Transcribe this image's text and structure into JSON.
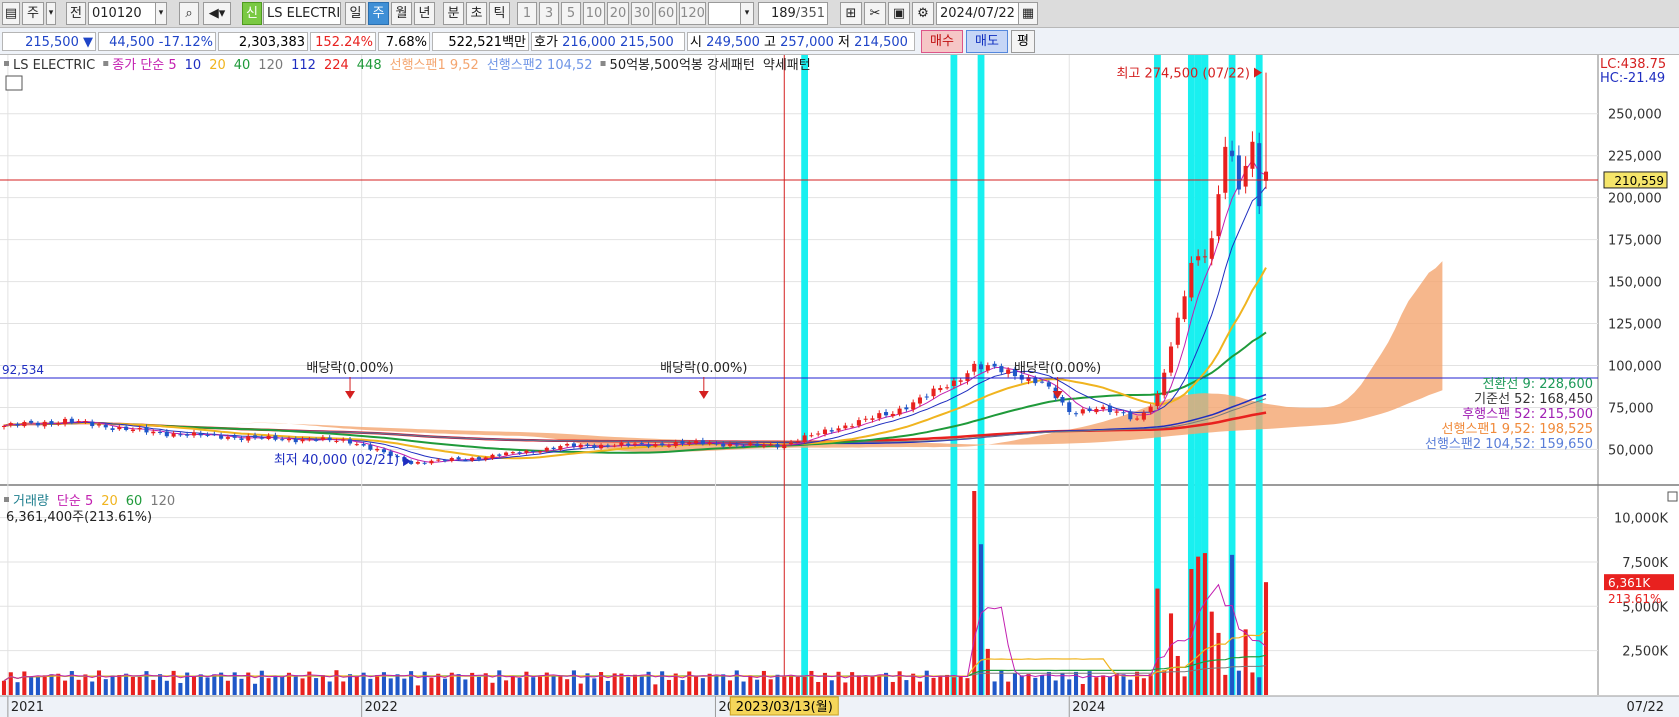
{
  "toolbar": {
    "period_label": "주",
    "prev_label": "전",
    "code": "010120",
    "new_badge": "신",
    "stock_name": "LS ELECTRI",
    "timeframes": [
      "일",
      "주",
      "월",
      "년",
      "분",
      "초",
      "틱"
    ],
    "active_timeframe": "주",
    "minute_options": [
      "1",
      "3",
      "5",
      "10",
      "20",
      "30",
      "60",
      "120"
    ],
    "bar_count": "189",
    "bar_total": "/351",
    "date": "2024/07/22"
  },
  "quote": {
    "price": "215,500",
    "change_arrow": "▼",
    "change": "44,500",
    "change_pct": "-17.12%",
    "volume": "2,303,383",
    "volume_ratio": "152.24%",
    "turnover": "7.68%",
    "trade_value": "522,521백만",
    "bid_label": "호가",
    "ask_price": "216,000",
    "bid_price": "215,500",
    "open_label": "시",
    "open": "249,500",
    "high_label": "고",
    "high": "257,000",
    "low_label": "저",
    "low": "214,500",
    "buy_label": "매수",
    "sell_label": "매도",
    "avg_label": "평"
  },
  "colors": {
    "up": "#e8211f",
    "down": "#1f57c8",
    "cyan_band": "#19f0f0",
    "cloud_up": "#f4a56f",
    "cloud_down": "#6f95e6",
    "ma5": "#c21fb0",
    "ma10": "#1f2ec0",
    "ma20": "#f0b41f",
    "ma40": "#1f9a3a",
    "ma120": "#7a7a7a"
  },
  "chart_data": [
    {
      "type": "candlestick",
      "title": "LS ELECTRIC",
      "legend": [
        {
          "text": "LS ELECTRIC",
          "color": "#333333"
        },
        {
          "text": "종가 단순 5",
          "color": "#c21fb0"
        },
        {
          "text": "10",
          "color": "#1f2ec0"
        },
        {
          "text": "20",
          "color": "#f0b41f"
        },
        {
          "text": "40",
          "color": "#1f9a3a"
        },
        {
          "text": "120",
          "color": "#7a7a7a"
        },
        {
          "text": "112",
          "color": "#1f2ec0"
        },
        {
          "text": "224",
          "color": "#e8211f"
        },
        {
          "text": "448",
          "color": "#1f9a3a"
        },
        {
          "text": "선행스팬1 9,52",
          "color": "#f4a56f"
        },
        {
          "text": "선행스팬2 104,52",
          "color": "#6f95e6"
        },
        {
          "text": "50억봉,500억봉 강세패턴",
          "color": "#222222"
        },
        {
          "text": "약세패턴",
          "color": "#222222"
        }
      ],
      "y_ticks": [
        50000,
        75000,
        100000,
        125000,
        150000,
        175000,
        200000,
        225000,
        250000
      ],
      "y_tick_labels": [
        "50,000",
        "75,000",
        "100,000",
        "125,000",
        "150,000",
        "175,000",
        "200,000",
        "225,000",
        "250,000"
      ],
      "ylim": [
        30000,
        285000
      ],
      "x_labels": [
        {
          "text": "2021",
          "date": "2021-01"
        },
        {
          "text": "2022",
          "date": "2022-01"
        },
        {
          "text": "2023",
          "date": "2023-01"
        },
        {
          "text": "2024",
          "date": "2024-01"
        }
      ],
      "right_top": {
        "lc": "LC:438.75",
        "hc": "HC:-21.49"
      },
      "current_price_tag": "210,559",
      "current_price": 210559,
      "horizontal_line": {
        "value": 92534,
        "label": "92,534"
      },
      "crosshair": {
        "date": "2023/03/13(월)"
      },
      "high_marker": {
        "text": "최고 274,500 (07/22)",
        "value": 274500
      },
      "low_marker": {
        "text": "최저 40,000 (02/21)",
        "value": 40000
      },
      "dividend_markers": [
        {
          "text": "배당락(0.00%)",
          "date": "2021-12"
        },
        {
          "text": "배당락(0.00%)",
          "date": "2022-12"
        },
        {
          "text": "배당락(0.00%)",
          "date": "2023-12"
        }
      ],
      "right_legend": [
        {
          "text": "전환선 9: 228,600",
          "color": "#1f9a5a"
        },
        {
          "text": "기준선 52: 168,450",
          "color": "#333333"
        },
        {
          "text": "후행스팬 52: 215,500",
          "color": "#a01fb4"
        },
        {
          "text": "선행스팬1 9,52: 198,525",
          "color": "#f08a3a"
        },
        {
          "text": "선행스팬2 104,52: 159,650",
          "color": "#5a7ed8"
        }
      ],
      "cyan_band_dates": [
        "2023-04-03",
        "2023-09-04",
        "2023-10-02",
        "2024-04-01",
        "2024-05-06",
        "2024-05-13",
        "2024-05-20",
        "2024-06-17",
        "2024-07-15"
      ],
      "keypoints": [
        {
          "date": "2020-12-28",
          "close": 64000
        },
        {
          "date": "2021-03-01",
          "close": 67000
        },
        {
          "date": "2021-06-01",
          "close": 60000
        },
        {
          "date": "2021-09-01",
          "close": 57000
        },
        {
          "date": "2021-12-20",
          "close": 55000
        },
        {
          "date": "2022-02-21",
          "close": 42000
        },
        {
          "date": "2022-05-01",
          "close": 45000
        },
        {
          "date": "2022-08-01",
          "close": 52000
        },
        {
          "date": "2022-11-01",
          "close": 53000
        },
        {
          "date": "2022-12-26",
          "close": 54000
        },
        {
          "date": "2023-02-01",
          "close": 52000
        },
        {
          "date": "2023-03-13",
          "close": 53000
        },
        {
          "date": "2023-05-01",
          "close": 62000
        },
        {
          "date": "2023-07-01",
          "close": 72000
        },
        {
          "date": "2023-09-01",
          "close": 90000
        },
        {
          "date": "2023-09-25",
          "close": 100000
        },
        {
          "date": "2023-11-01",
          "close": 96000
        },
        {
          "date": "2023-12-01",
          "close": 90000
        },
        {
          "date": "2024-01-01",
          "close": 72000
        },
        {
          "date": "2024-02-01",
          "close": 75000
        },
        {
          "date": "2024-03-11",
          "close": 68000
        },
        {
          "date": "2024-04-01",
          "close": 82000
        },
        {
          "date": "2024-04-22",
          "close": 125000
        },
        {
          "date": "2024-05-06",
          "close": 160000
        },
        {
          "date": "2024-05-27",
          "close": 175000
        },
        {
          "date": "2024-06-10",
          "close": 232000
        },
        {
          "date": "2024-06-24",
          "close": 205000
        },
        {
          "date": "2024-07-08",
          "close": 230000
        },
        {
          "date": "2024-07-15",
          "close": 200000
        },
        {
          "date": "2024-07-22",
          "close": 215500
        }
      ]
    },
    {
      "type": "bar",
      "title": "거래량",
      "legend": [
        {
          "text": "거래량",
          "color": "#1f7f8f"
        },
        {
          "text": "단순 5",
          "color": "#c21fb0"
        },
        {
          "text": "20",
          "color": "#f0b41f"
        },
        {
          "text": "60",
          "color": "#1f9a3a"
        },
        {
          "text": "120",
          "color": "#7a7a7a"
        }
      ],
      "summary": "6,361,400주(213.61%)",
      "y_ticks": [
        2500,
        5000,
        7500,
        10000
      ],
      "y_tick_labels": [
        "2,500K",
        "5,000K",
        "7,500K",
        "10,000K"
      ],
      "ylim": [
        0,
        11500
      ],
      "current_volume_tag": "6,361K",
      "current_volume_pct": "213.61%",
      "current_volume": 6361,
      "unit": "K",
      "spikes": [
        {
          "date": "2023-03-13",
          "value": 1100
        },
        {
          "date": "2023-09-04",
          "value": 1000
        },
        {
          "date": "2023-09-25",
          "value": 11500
        },
        {
          "date": "2023-10-02",
          "value": 8500
        },
        {
          "date": "2023-10-09",
          "value": 2600
        },
        {
          "date": "2024-04-01",
          "value": 6000
        },
        {
          "date": "2024-04-15",
          "value": 4600
        },
        {
          "date": "2024-04-22",
          "value": 2200
        },
        {
          "date": "2024-05-06",
          "value": 7100
        },
        {
          "date": "2024-05-13",
          "value": 7800
        },
        {
          "date": "2024-05-20",
          "value": 8000
        },
        {
          "date": "2024-05-27",
          "value": 4700
        },
        {
          "date": "2024-06-03",
          "value": 3500
        },
        {
          "date": "2024-06-17",
          "value": 7900
        },
        {
          "date": "2024-07-01",
          "value": 3700
        },
        {
          "date": "2024-07-22",
          "value": 6361
        }
      ]
    }
  ],
  "footer": {
    "last_date": "07/22"
  }
}
